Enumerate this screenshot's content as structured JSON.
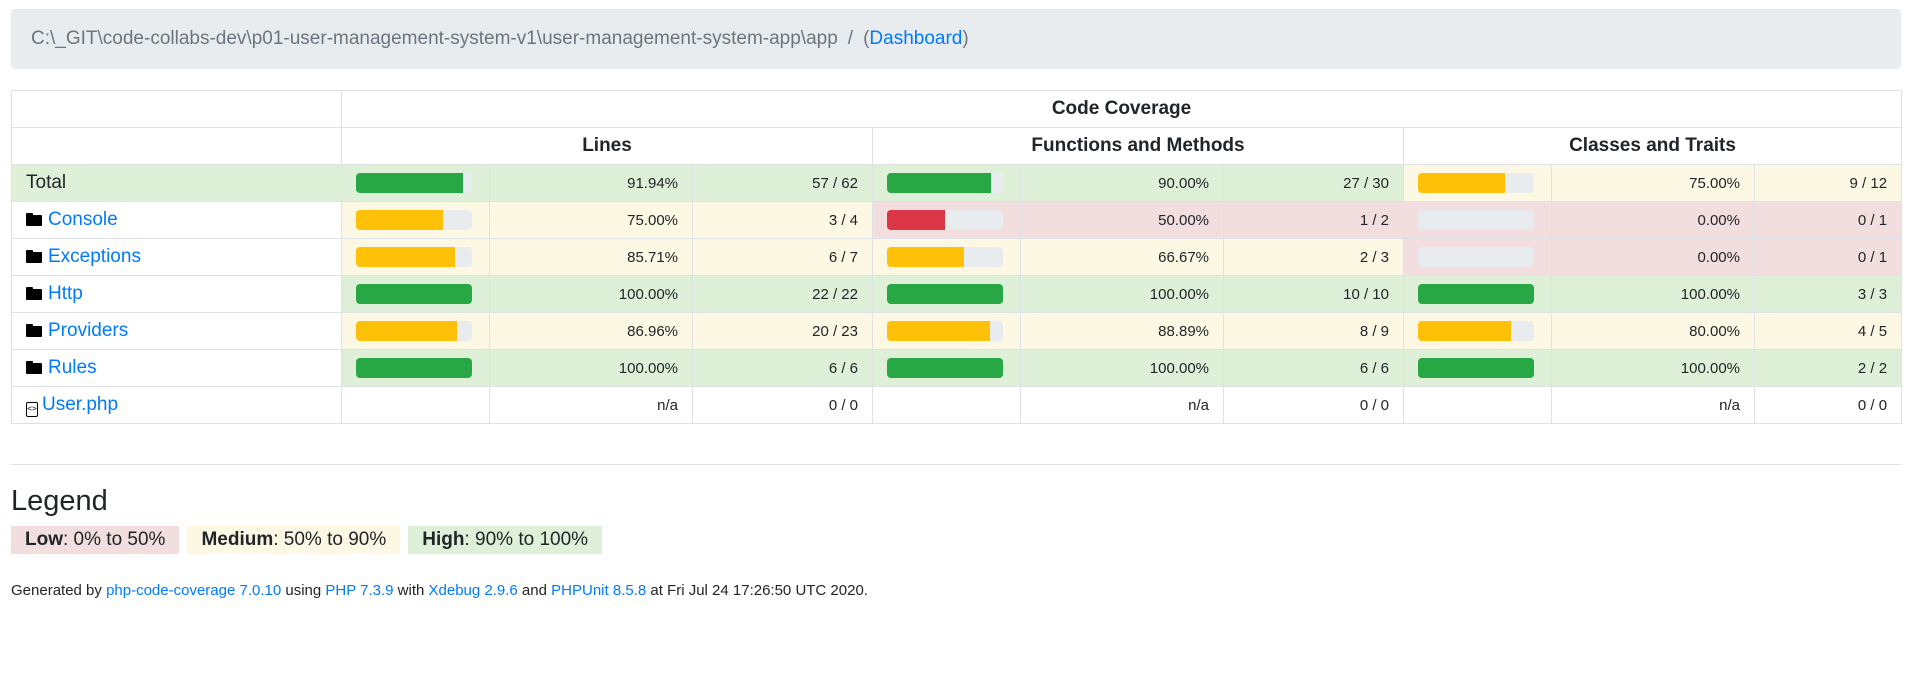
{
  "breadcrumb": {
    "path": "C:\\_GIT\\code-collabs-dev\\p01-user-management-system-v1\\user-management-system-app\\app",
    "separator": "/",
    "open_paren": "(",
    "dashboard_link": "Dashboard",
    "close_paren": ")"
  },
  "table": {
    "header_main": "Code Coverage",
    "header_lines": "Lines",
    "header_functions": "Functions and Methods",
    "header_classes": "Classes and Traits",
    "rows": [
      {
        "name": "Total",
        "type": "total",
        "lines_pct": "91.94%",
        "lines_ratio": "57 / 62",
        "lines_fill": 91.94,
        "lines_level": "success",
        "func_pct": "90.00%",
        "func_ratio": "27 / 30",
        "func_fill": 90.0,
        "func_level": "success",
        "cls_pct": "75.00%",
        "cls_ratio": "9 / 12",
        "cls_fill": 75.0,
        "cls_level": "warning"
      },
      {
        "name": "Console",
        "type": "folder",
        "lines_pct": "75.00%",
        "lines_ratio": "3 / 4",
        "lines_fill": 75.0,
        "lines_level": "warning",
        "func_pct": "50.00%",
        "func_ratio": "1 / 2",
        "func_fill": 50.0,
        "func_level": "danger",
        "cls_pct": "0.00%",
        "cls_ratio": "0 / 1",
        "cls_fill": 0.0,
        "cls_level": "danger"
      },
      {
        "name": "Exceptions",
        "type": "folder",
        "lines_pct": "85.71%",
        "lines_ratio": "6 / 7",
        "lines_fill": 85.71,
        "lines_level": "warning",
        "func_pct": "66.67%",
        "func_ratio": "2 / 3",
        "func_fill": 66.67,
        "func_level": "warning",
        "cls_pct": "0.00%",
        "cls_ratio": "0 / 1",
        "cls_fill": 0.0,
        "cls_level": "danger"
      },
      {
        "name": "Http",
        "type": "folder",
        "lines_pct": "100.00%",
        "lines_ratio": "22 / 22",
        "lines_fill": 100.0,
        "lines_level": "success",
        "func_pct": "100.00%",
        "func_ratio": "10 / 10",
        "func_fill": 100.0,
        "func_level": "success",
        "cls_pct": "100.00%",
        "cls_ratio": "3 / 3",
        "cls_fill": 100.0,
        "cls_level": "success"
      },
      {
        "name": "Providers",
        "type": "folder",
        "lines_pct": "86.96%",
        "lines_ratio": "20 / 23",
        "lines_fill": 86.96,
        "lines_level": "warning",
        "func_pct": "88.89%",
        "func_ratio": "8 / 9",
        "func_fill": 88.89,
        "func_level": "warning",
        "cls_pct": "80.00%",
        "cls_ratio": "4 / 5",
        "cls_fill": 80.0,
        "cls_level": "warning"
      },
      {
        "name": "Rules",
        "type": "folder",
        "lines_pct": "100.00%",
        "lines_ratio": "6 / 6",
        "lines_fill": 100.0,
        "lines_level": "success",
        "func_pct": "100.00%",
        "func_ratio": "6 / 6",
        "func_fill": 100.0,
        "func_level": "success",
        "cls_pct": "100.00%",
        "cls_ratio": "2 / 2",
        "cls_fill": 100.0,
        "cls_level": "success"
      },
      {
        "name": "User.php",
        "type": "file",
        "lines_pct": "n/a",
        "lines_ratio": "0 / 0",
        "lines_fill": null,
        "lines_level": "none",
        "func_pct": "n/a",
        "func_ratio": "0 / 0",
        "func_fill": null,
        "func_level": "none",
        "cls_pct": "n/a",
        "cls_ratio": "0 / 0",
        "cls_fill": null,
        "cls_level": "none"
      }
    ]
  },
  "legend": {
    "title": "Legend",
    "low_label": "Low",
    "low_range": ": 0% to 50%",
    "medium_label": "Medium",
    "medium_range": ": 50% to 90%",
    "high_label": "High",
    "high_range": ": 90% to 100%"
  },
  "footer": {
    "generated_by": "Generated by ",
    "tool_link": "php-code-coverage 7.0.10",
    "using": " using ",
    "php_link": "PHP 7.3.9",
    "with": " with ",
    "xdebug_link": "Xdebug 2.9.6",
    "and": " and ",
    "phpunit_link": "PHPUnit 8.5.8",
    "at": " at Fri Jul 24 17:26:50 UTC 2020."
  },
  "colors": {
    "success_bg": "#dff0d8",
    "warning_bg": "#fcf8e3",
    "danger_bg": "#f2dede",
    "success_bar": "#28a745",
    "warning_bar": "#ffc107",
    "danger_bar": "#dc3545",
    "link": "#007bff"
  },
  "icons": {
    "folder": "folder-icon",
    "file": "file-code-icon"
  }
}
